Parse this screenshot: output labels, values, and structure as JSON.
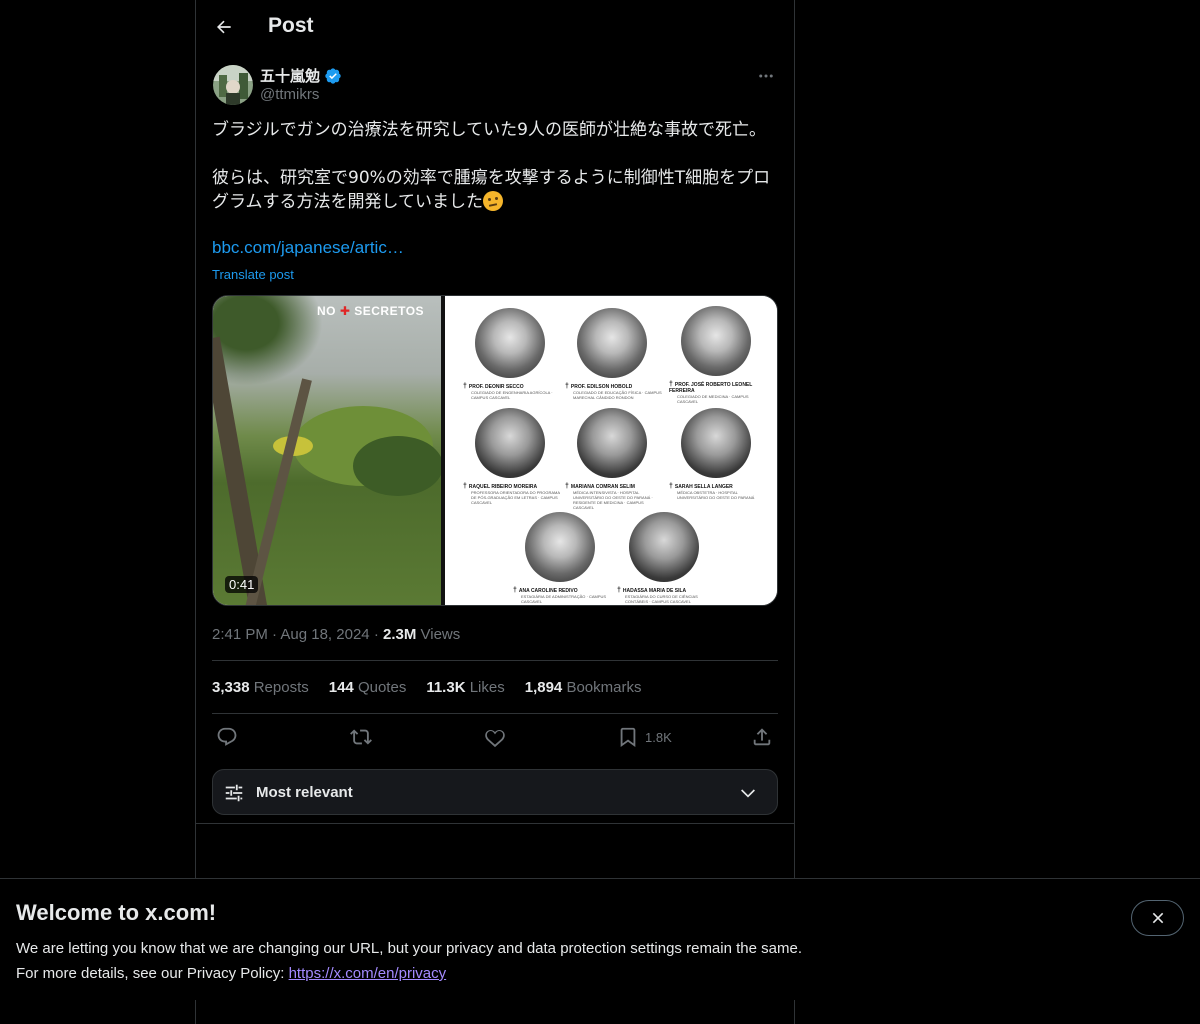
{
  "header": {
    "title": "Post",
    "back_icon": "arrow-left-icon"
  },
  "author": {
    "name": "五十嵐勉",
    "handle": "@ttmikrs",
    "verified": true,
    "verified_color": "#1d9bf0"
  },
  "post": {
    "line1": "ブラジルでガンの治療法を研究していた9人の医師が壮絶な事故で死亡。",
    "line2": "彼らは、研究室で90%の効率で腫瘍を攻撃するように制御性T細胞をプロ",
    "line3": "グラムする方法を開発していました",
    "link": "bbc.com/japanese/artic…",
    "translate": "Translate post"
  },
  "media": {
    "duration": "0:41",
    "brand_left": "NO",
    "brand_right": "SECRETOS",
    "people": [
      {
        "name": "PROF. DEONIR SECCO",
        "desc": "COLEGIADO DE ENGENHARIA AGRÍCOLA · CAMPUS CASCAVEL"
      },
      {
        "name": "PROF. EDILSON HOBOLD",
        "desc": "COLEGIADO DE EDUCAÇÃO FÍSICA · CAMPUS MARECHAL CÂNDIDO RONDON"
      },
      {
        "name": "PROF. JOSÉ ROBERTO LEONEL FERREIRA",
        "desc": "COLEGIADO DE MEDICINA · CAMPUS CASCAVEL"
      },
      {
        "name": "RAQUEL RIBEIRO MOREIRA",
        "desc": "PROFESSORA ORIENTADORA DO PROGRAMA DE PÓS-GRADUAÇÃO EM LETRAS · CAMPUS CASCAVEL"
      },
      {
        "name": "MARIANA COMRAN SELIM",
        "desc": "MÉDICA INTENSIVISTA · HOSPITAL UNIVERSITÁRIO DO OESTE DO PARANÁ · RESIDENTE DE MEDICINA · CAMPUS CASCAVEL"
      },
      {
        "name": "SARAH SELLA LANGER",
        "desc": "MÉDICA OBSTETRA · HOSPITAL UNIVERSITÁRIO DO OESTE DO PARANÁ"
      },
      {
        "name": "ANA CAROLINE REDIVO",
        "desc": "ESTAGIÁRIA DE ADMINISTRAÇÃO · CAMPUS CASCAVEL"
      },
      {
        "name": "HADASSA MARIA DE SILA",
        "desc": "ESTAGIÁRIA DO CURSO DE CIÊNCIAS CONTÁBEIS · CAMPUS CASCAVEL"
      }
    ]
  },
  "meta": {
    "time": "2:41 PM",
    "date": "Aug 18, 2024",
    "views_count": "2.3M",
    "views_label": "Views"
  },
  "stats": {
    "reposts_count": "3,338",
    "reposts_label": "Reposts",
    "quotes_count": "144",
    "quotes_label": "Quotes",
    "likes_count": "11.3K",
    "likes_label": "Likes",
    "bookmarks_count": "1,894",
    "bookmarks_label": "Bookmarks"
  },
  "actions": {
    "bookmark_count": "1.8K"
  },
  "sort": {
    "label": "Most relevant"
  },
  "banner": {
    "title": "Welcome to x.com!",
    "line1": "We are letting you know that we are changing our URL, but your privacy and data protection settings remain the same.",
    "line2_prefix": "For more details, see our Privacy Policy: ",
    "link": "https://x.com/en/privacy"
  },
  "colors": {
    "background": "#000000",
    "accent": "#1d9bf0",
    "muted": "#71767b",
    "border": "#2f3336",
    "banner_link": "#a48bff"
  }
}
